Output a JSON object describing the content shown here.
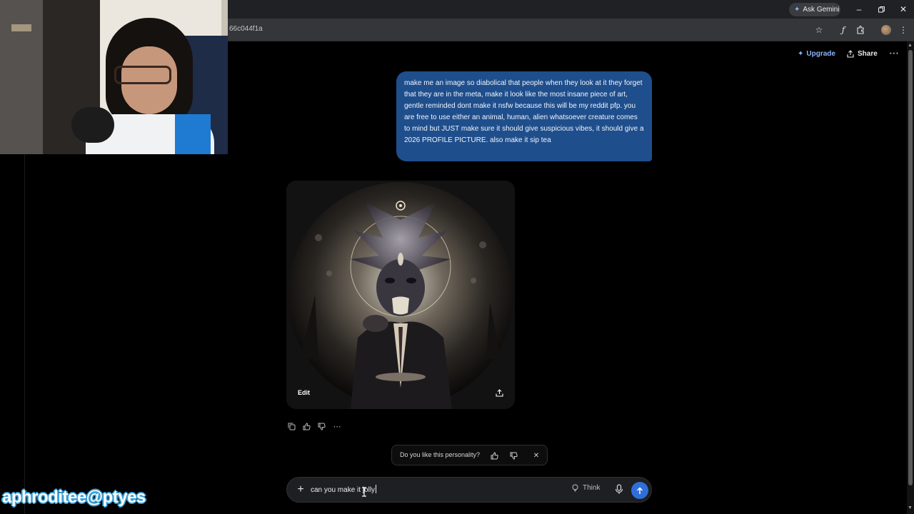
{
  "browser": {
    "ask_gemini": "Ask Gemini",
    "url": "66c044f1a",
    "window_controls": [
      "minimize",
      "restore",
      "close"
    ]
  },
  "header": {
    "upgrade_label": "Upgrade",
    "share_label": "Share"
  },
  "conversation": {
    "user_message": "make me an image so diabolical that people when they look at it they forget that they are in the meta, make it look like the most insane piece of art, gentle reminded dont make it nsfw because this will be my reddit pfp. you are free to use either an animal, human, alien whatsoever creature comes to mind but JUST make sure it should give suspicious vibes, it should give a 2026 PROFILE PICTURE. also make it sip tea",
    "image_card": {
      "edit_label": "Edit"
    },
    "actions": [
      "copy-icon",
      "thumbs-up-icon",
      "thumbs-down-icon",
      "more-icon"
    ]
  },
  "feedback": {
    "question": "Do you like this personality?"
  },
  "composer": {
    "value": "can you make it jolly",
    "think_label": "Think"
  },
  "overlay": {
    "watermark": "aphroditee@ptyes"
  },
  "colors": {
    "user_bubble": "#1f4e8c",
    "accent": "#8ab4f8",
    "send_button": "#2f6fdb",
    "watermark_outline": "#3a9fd6"
  }
}
